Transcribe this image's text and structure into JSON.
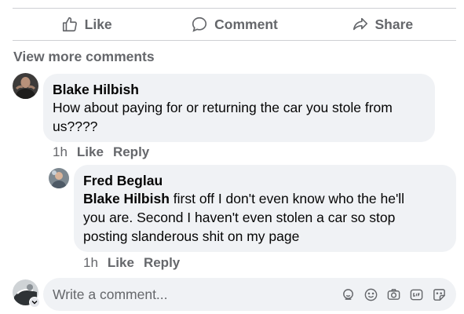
{
  "actions": {
    "like": "Like",
    "comment": "Comment",
    "share": "Share"
  },
  "view_more": "View more comments",
  "comments": [
    {
      "author": "Blake Hilbish",
      "text_lines": [
        "How about paying for or returning the car you stole from",
        "us????"
      ],
      "time": "1h",
      "like": "Like",
      "reply": "Reply"
    }
  ],
  "reply": {
    "author": "Fred Beglau",
    "mention": "Blake Hilbish",
    "text_line1_rest": " first off I don't even know who the he'll",
    "text_line2": "you are. Second I haven't even stolen a car so stop",
    "text_line3": "posting slanderous shit on my page",
    "time": "1h",
    "like": "Like",
    "reply": "Reply"
  },
  "composer": {
    "placeholder": "Write a comment...",
    "tool_icons": [
      "avatar-sticker-icon",
      "emoji-icon",
      "camera-icon",
      "gif-icon",
      "sticker-icon"
    ]
  }
}
